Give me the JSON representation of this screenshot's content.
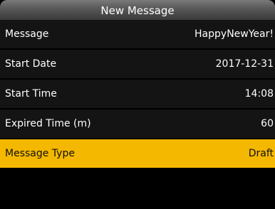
{
  "header": {
    "title": "New Message"
  },
  "settings": [
    {
      "label": "Message",
      "value": "HappyNewYear!"
    },
    {
      "label": "Start Date",
      "value": "2017-12-31"
    },
    {
      "label": "Start Time",
      "value": "14:08"
    },
    {
      "label": "Expired Time (m)",
      "value": "60"
    },
    {
      "label": "Message Type",
      "value": "Draft"
    }
  ],
  "colors": {
    "background": "#000000",
    "row_background": "#141414",
    "selected_row": "#f5b800",
    "title_bar": "#5a5a5a"
  }
}
